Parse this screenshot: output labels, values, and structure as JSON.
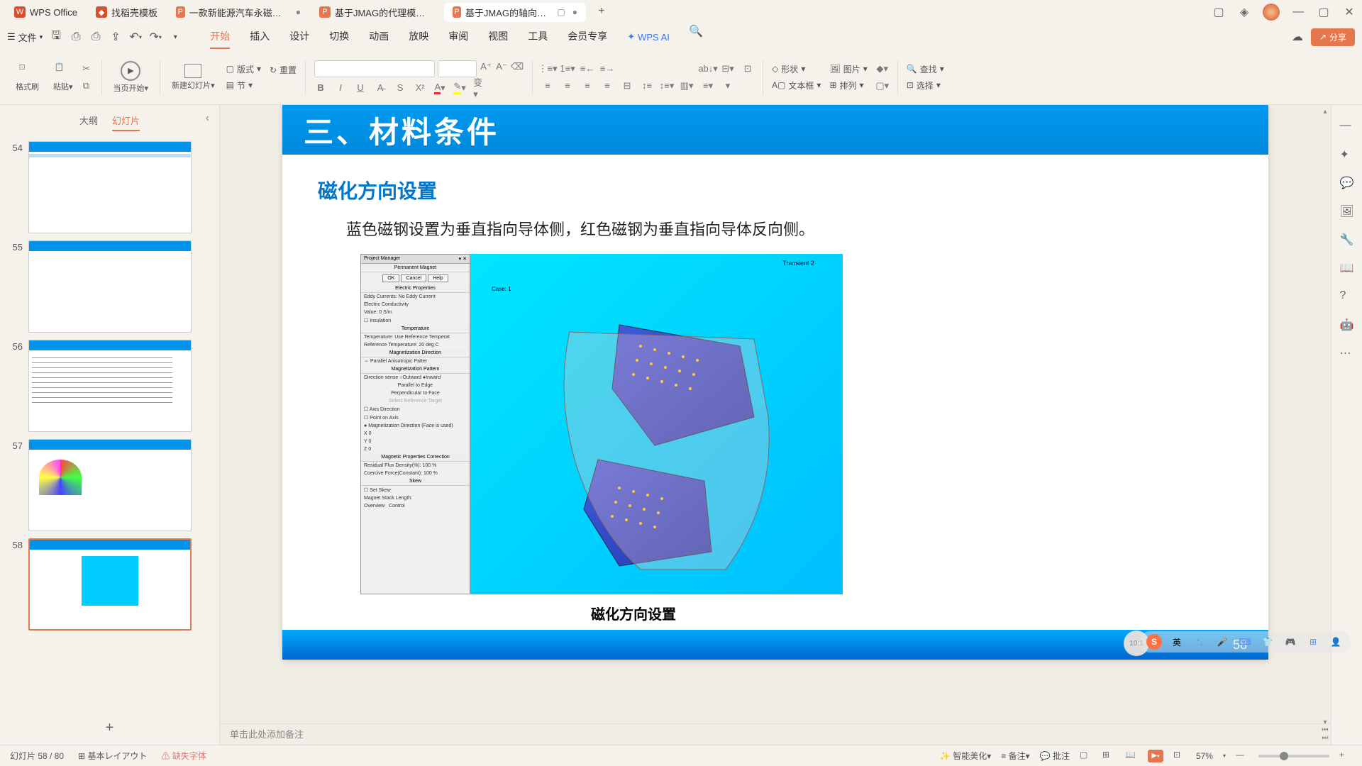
{
  "titleTabs": [
    {
      "icon": "wps",
      "label": "WPS Office"
    },
    {
      "icon": "dao",
      "label": "找稻壳模板"
    },
    {
      "icon": "p",
      "label": "一款新能源汽车永磁电机的优化"
    },
    {
      "icon": "p",
      "label": "基于JMAG的代理模型多目标遗传算法"
    },
    {
      "icon": "p",
      "label": "基于JMAG的轴向气隙电机虚"
    }
  ],
  "activeTabIndex": 4,
  "fileMenu": "文件",
  "menuTabs": [
    "开始",
    "插入",
    "设计",
    "切换",
    "动画",
    "放映",
    "审阅",
    "视图",
    "工具",
    "会员专享"
  ],
  "activeMenuTab": "开始",
  "wpsAI": "WPS AI",
  "shareLabel": "分享",
  "ribbon": {
    "formatBrush": "格式刷",
    "paste": "粘贴",
    "pageStart": "当页开始",
    "newSlide": "新建幻灯片",
    "layout": "版式",
    "reset": "重置",
    "section": "节",
    "shape": "形状",
    "textbox": "文本框",
    "picture": "图片",
    "arrange": "排列",
    "find": "查找",
    "select": "选择"
  },
  "panelTabs": {
    "outline": "大纲",
    "slides": "幻灯片"
  },
  "thumbs": [
    54,
    55,
    56,
    57,
    58
  ],
  "currentSlide": 58,
  "slide": {
    "title": "三、材料条件",
    "subtitle": "磁化方向设置",
    "body": "蓝色磁钢设置为垂直指向导体侧，红色磁钢为垂直指向导体反向侧。",
    "caption": "磁化方向设置",
    "pageNum": "58",
    "pm": {
      "header": "Project Manager",
      "title": "Permanent Magnet",
      "ok": "OK",
      "cancel": "Cancel",
      "help": "Help",
      "elecProps": "Electric Properties",
      "eddy": "Eddy Currents:",
      "eddyVal": "No Eddy Current",
      "cond": "Electric Conductivity",
      "value": "Value:",
      "valueNum": "0",
      "valueUnit": "S/m",
      "insulation": "Insulation",
      "temperature": "Temperature",
      "tempLabel": "Temperature:",
      "tempVal": "Use Reference Temperat",
      "refTemp": "Reference Temperature:",
      "refTempNum": "20",
      "refTempUnit": "deg C",
      "magDir": "Magnetization Direction",
      "parallel": "Parallel Anisotropic Patter",
      "dirSense": "Direction sense",
      "outward": "Outward",
      "inward": "Inward",
      "parEdge": "Parallel to Edge",
      "perpFace": "Perpendicular to Face",
      "selRef": "Select Reference Target",
      "axisDir": "Axis Direction",
      "pointAxis": "Point on Axis",
      "magPat": "Magnetization Pattern",
      "magDir2": "Magnetization Direction (Face is used)",
      "x": "X",
      "y": "Y",
      "z": "Z",
      "magProps": "Magnetic Properties Correction",
      "resFlux": "Residual Flux Density(%):",
      "resFluxNum": "100",
      "coercive": "Coercive Force(Constant):",
      "coerciveNum": "100",
      "skew": "Skew",
      "setSkew": "Set Skew",
      "stackLen": "Magnet Stack Length:",
      "overview": "Overview",
      "control": "Control",
      "vizLabel": "Transient 2",
      "vizCase": "Case: 1"
    }
  },
  "notes": "单击此处添加备注",
  "status": {
    "slideCount": "幻灯片 58 / 80",
    "layout": "基本レイアウト",
    "missingFont": "缺失字体",
    "beautify": "智能美化",
    "notesBtn": "备注",
    "comments": "批注",
    "zoom": "57%"
  },
  "ime": {
    "lang": "英"
  }
}
